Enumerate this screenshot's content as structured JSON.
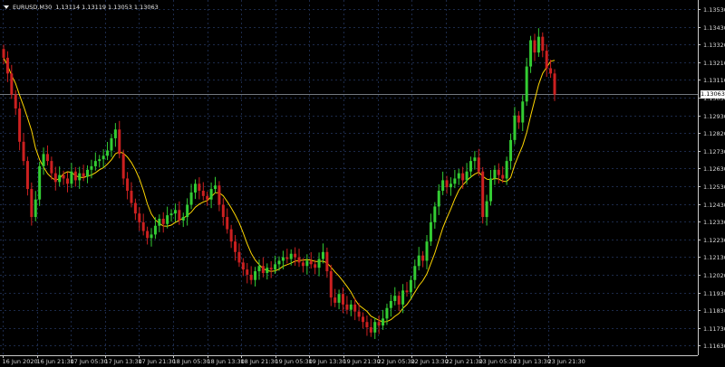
{
  "header": {
    "symbol": "EURUSD,M30",
    "open": "1.13114",
    "high": "1.13119",
    "low": "1.13053",
    "close": "1.13063"
  },
  "current_price": "1.13063",
  "colors": {
    "background": "#000000",
    "grid": "#1c2a4a",
    "axis": "#c8c8c8",
    "bull": "#33cc33",
    "bear": "#cc2020",
    "ma": "#ffd700",
    "bid_line": "#9aa0aa",
    "text": "#d8d8d8"
  },
  "chart_data": {
    "type": "candlestick",
    "title": "EURUSD,M30",
    "y_axis_labels": [
      "1.13530",
      "1.13430",
      "1.13320",
      "1.13210",
      "1.13110",
      "1.13030",
      "1.12930",
      "1.12820",
      "1.12730",
      "1.12630",
      "1.12530",
      "1.12430",
      "1.12330",
      "1.12230",
      "1.12130",
      "1.12020",
      "1.11930",
      "1.11830",
      "1.11730",
      "1.11630"
    ],
    "x_axis_labels": [
      "16 Jun 2020",
      "16 Jun 21:30",
      "17 Jun 05:30",
      "17 Jun 13:30",
      "17 Jun 21:30",
      "18 Jun 05:30",
      "18 Jun 13:30",
      "18 Jun 21:30",
      "19 Jun 05:30",
      "19 Jun 13:30",
      "19 Jun 21:30",
      "22 Jun 05:30",
      "22 Jun 13:30",
      "22 Jun 21:30",
      "23 Jun 05:30",
      "23 Jun 13:30",
      "23 Jun 21:30"
    ],
    "ylim": [
      1.1157,
      1.136
    ],
    "moving_average": "yellow line",
    "closes": [
      1.1327,
      1.1318,
      1.1306,
      1.1298,
      1.1279,
      1.1268,
      1.1252,
      1.1236,
      1.1246,
      1.1265,
      1.1272,
      1.1268,
      1.1261,
      1.1256,
      1.126,
      1.1258,
      1.1255,
      1.1262,
      1.1257,
      1.1261,
      1.1259,
      1.1263,
      1.1265,
      1.1268,
      1.1269,
      1.1271,
      1.1274,
      1.1281,
      1.1286,
      1.1272,
      1.1258,
      1.1251,
      1.1244,
      1.1238,
      1.1233,
      1.1228,
      1.1224,
      1.1226,
      1.1231,
      1.1235,
      1.1232,
      1.1237,
      1.1238,
      1.124,
      1.1234,
      1.1236,
      1.1243,
      1.125,
      1.1255,
      1.1251,
      1.1248,
      1.1246,
      1.1252,
      1.1254,
      1.1243,
      1.1236,
      1.1229,
      1.1222,
      1.1216,
      1.121,
      1.1206,
      1.1203,
      1.12,
      1.1205,
      1.1208,
      1.1204,
      1.1207,
      1.1206,
      1.1209,
      1.1211,
      1.1213,
      1.1212,
      1.1215,
      1.1213,
      1.121,
      1.1208,
      1.1211,
      1.1209,
      1.1207,
      1.1212,
      1.1216,
      1.1205,
      1.119,
      1.1187,
      1.1192,
      1.1186,
      1.1183,
      1.1186,
      1.1182,
      1.1179,
      1.1176,
      1.1173,
      1.117,
      1.1176,
      1.1174,
      1.1178,
      1.1184,
      1.1188,
      1.1191,
      1.1186,
      1.1194,
      1.1193,
      1.12,
      1.1208,
      1.1214,
      1.1211,
      1.1222,
      1.1233,
      1.1242,
      1.1251,
      1.1257,
      1.1253,
      1.1255,
      1.1258,
      1.1261,
      1.1257,
      1.1262,
      1.1268,
      1.127,
      1.1262,
      1.1236,
      1.1245,
      1.1258,
      1.1263,
      1.126,
      1.1258,
      1.1268,
      1.128,
      1.1294,
      1.129,
      1.1302,
      1.1322,
      1.1337,
      1.133,
      1.1339,
      1.1331,
      1.1321,
      1.1318,
      1.1306
    ]
  }
}
